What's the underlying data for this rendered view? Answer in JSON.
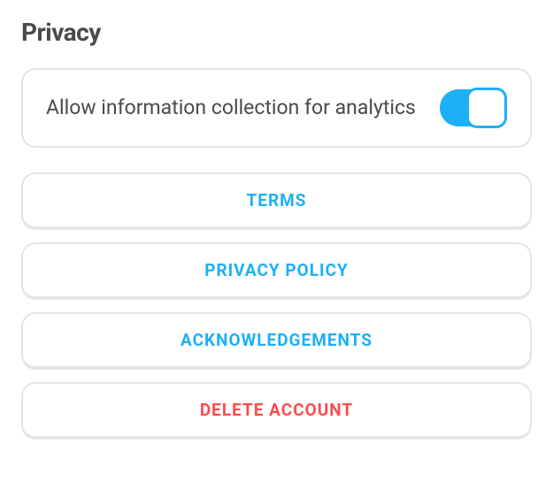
{
  "section": {
    "title": "Privacy"
  },
  "analytics": {
    "label": "Allow information collection for analytics",
    "enabled": true
  },
  "links": {
    "terms": "TERMS",
    "privacy": "PRIVACY POLICY",
    "acknowledgements": "ACKNOWLEDGEMENTS",
    "delete": "DELETE ACCOUNT"
  },
  "colors": {
    "accent": "#1cb0f6",
    "danger": "#ff4b4b"
  }
}
